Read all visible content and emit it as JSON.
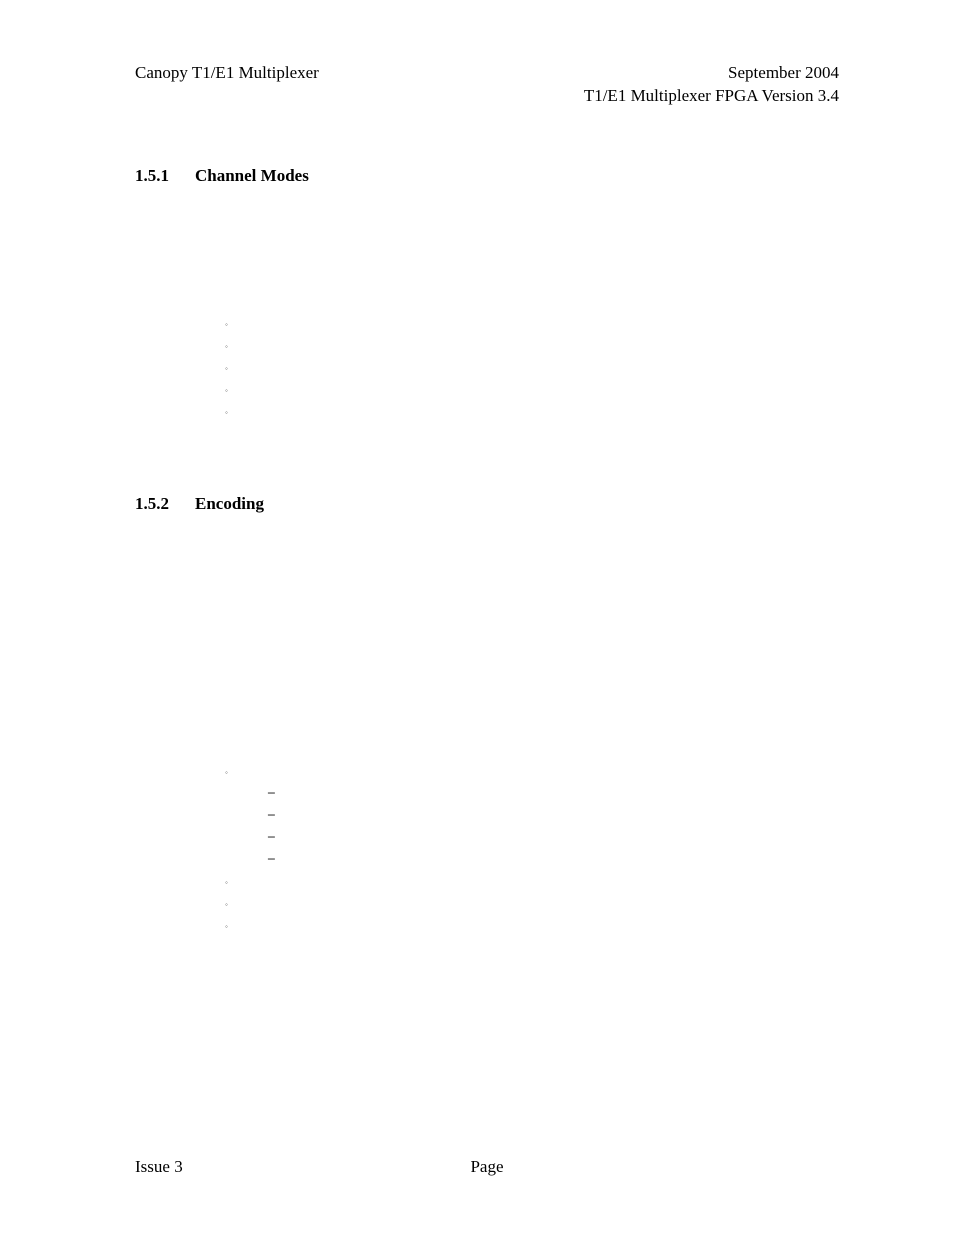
{
  "header": {
    "left": "Canopy T1/E1 Multiplexer",
    "right_line1": "September 2004",
    "right_line2": "T1/E1 Multiplexer FPGA Version 3.4"
  },
  "sections": {
    "s1": {
      "number": "1.5.1",
      "title": "Channel Modes"
    },
    "s2": {
      "number": "1.5.2",
      "title": "Encoding"
    }
  },
  "footer": {
    "left": "Issue 3",
    "center": "Page"
  },
  "markers": {
    "circle": "◦",
    "dash": "−"
  }
}
